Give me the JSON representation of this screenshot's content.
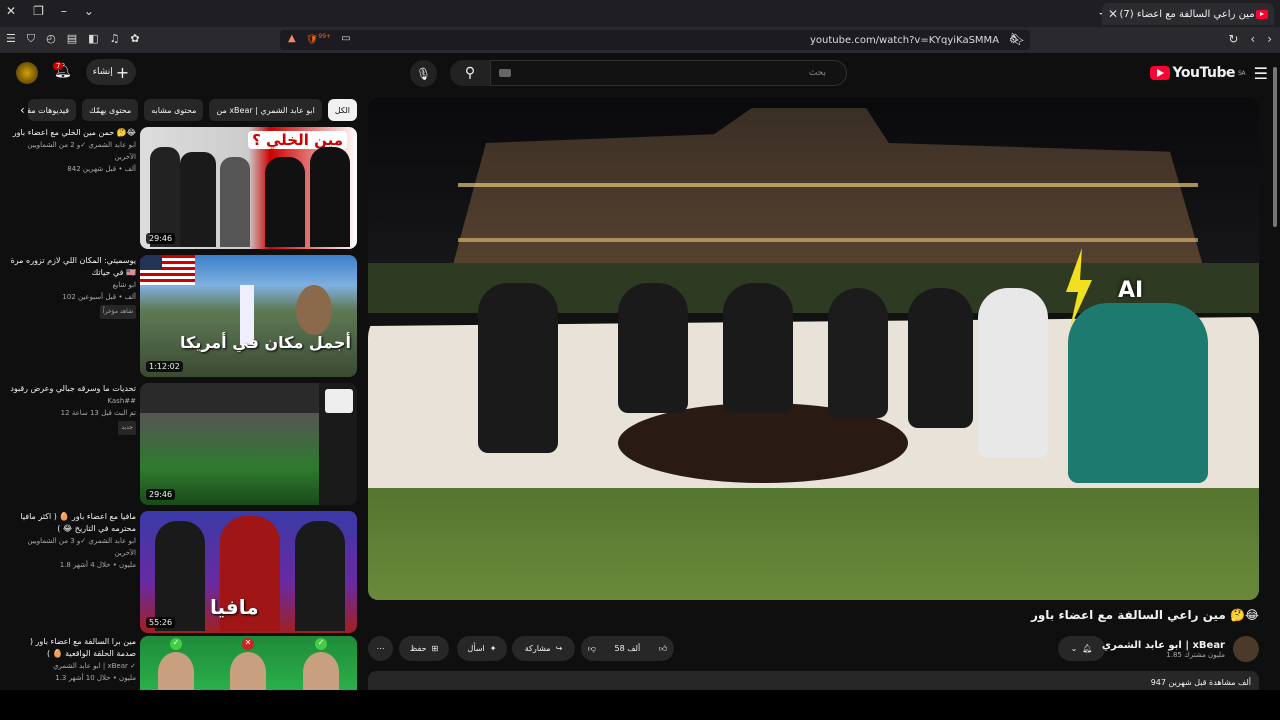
{
  "browser": {
    "tab_title": "(7) مين راعي السالفة مع اعضاء",
    "url": "youtube.com/watch?v=KYqyiKaSMMA",
    "ext_badge": "99+"
  },
  "yt": {
    "logo": "YouTube",
    "region": "SA",
    "search_placeholder": "بحث",
    "create_label": "إنشاء",
    "notif_count": "7"
  },
  "chips": [
    "الكل",
    "من xBear | ابو عابد الشمري",
    "محتوى مشابه",
    "محتوى يهمّك",
    "فيديوهات مقترحة"
  ],
  "recs": [
    {
      "title": "حمن مين الخلي مع اعضاء باور 🤔😂",
      "channel": "ابو عابد الشمري ✓و 2 من الشماويين الآخرين",
      "stats": "842 ألف • قبل شهرين",
      "dur": "29:46",
      "thumb_text": "مين الخلي ؟",
      "tag": ""
    },
    {
      "title": "يوسميتي: المكان اللي لازم تزوره مرة في حياتك 🇺🇸",
      "channel": "ابو شايع",
      "stats": "102 ألف • قبل أسبوعين",
      "dur": "1:12:02",
      "thumb_text": "أجمل مكان في أمريكا",
      "tag": "شاهد مؤخراً"
    },
    {
      "title": "تحديات ما وسرقه جبالي وعرض رقبود",
      "channel": "Kash##",
      "stats": "12 تم البث قبل 13 ساعة",
      "dur": "29:46",
      "thumb_text": "",
      "tag": "جديد"
    },
    {
      "title": "مافيا مع اعضاء باور 🥚 ( اكثر مافيا محترمه في التاريخ 😂 )",
      "channel": "ابو عابد الشمري ✓و 3 من الشماويين الآخرين",
      "stats": "1.8 مليون • خلال 4 أشهر",
      "dur": "55:26",
      "thumb_text": "مافيا",
      "tag": ""
    },
    {
      "title": "مين برا السالفة مع اعضاء باور ( صدمة الحلقة الواقعية 🥚 )",
      "channel": "ابو عابد الشمري | xBear ✓",
      "stats": "1.3 مليون • خلال 10 أشهر",
      "dur": "",
      "thumb_text": "",
      "tag": ""
    }
  ],
  "video": {
    "title": "مين راعي السالفة مع اعضاء باور 🤔😂",
    "channel": "ابو عابد الشمري | xBear",
    "subs": "1.85 مليون مشترك",
    "likes": "58 ألف",
    "share": "مشاركة",
    "ask": "اسأل",
    "save": "حفظ",
    "views": "947 ألف مشاهدة قبل شهرين",
    "overlay": "AI"
  }
}
